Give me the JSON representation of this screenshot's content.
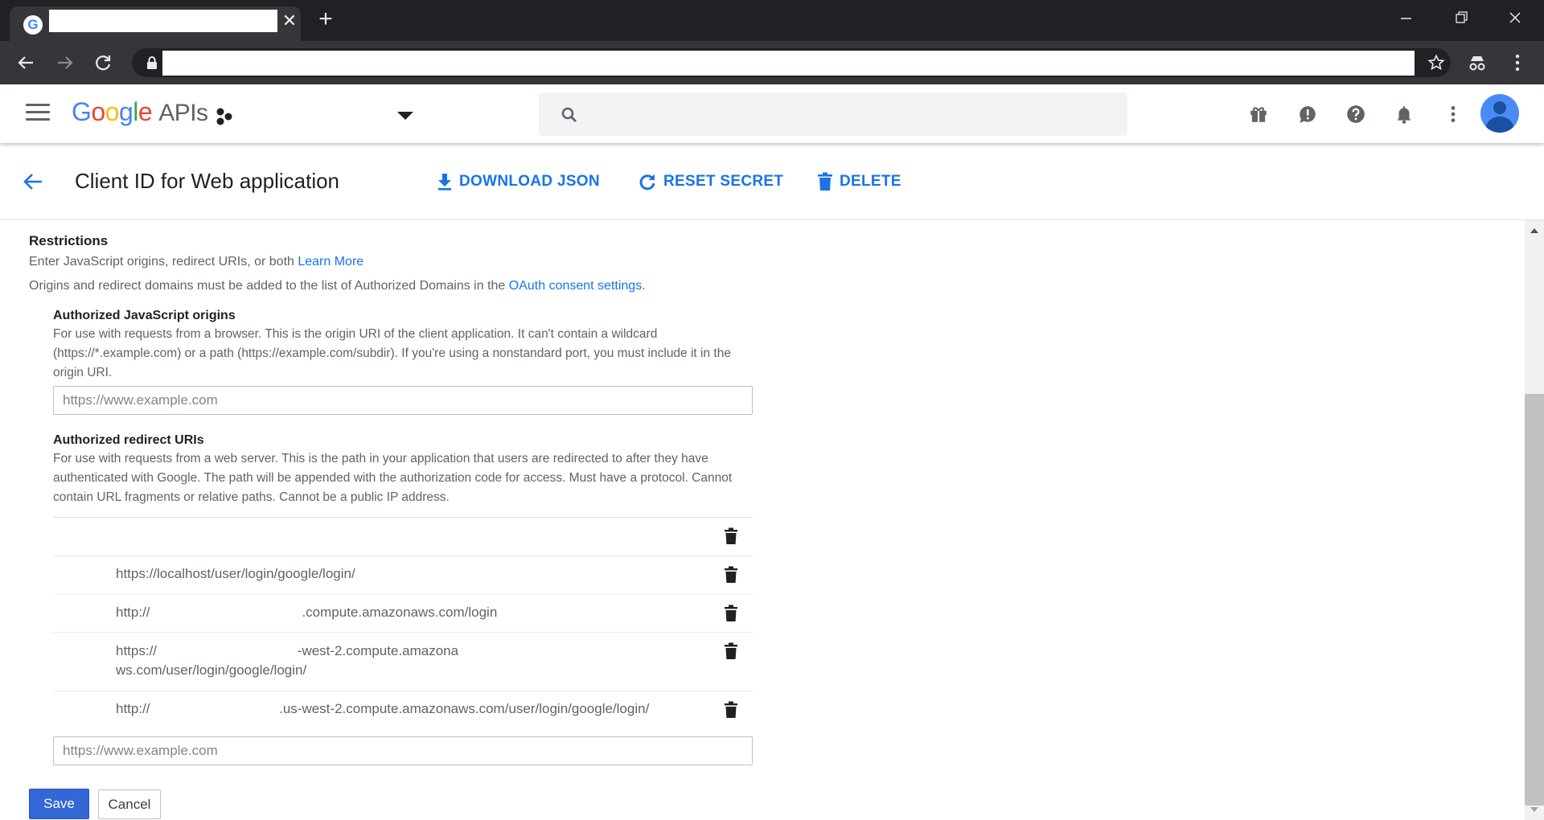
{
  "browser": {
    "tab_favicon_letter": "G",
    "tab_close_glyph": "✕",
    "new_tab_glyph": "+"
  },
  "header": {
    "logo": [
      "G",
      "o",
      "o",
      "g",
      "l",
      "e"
    ],
    "logo_suffix": "APIs",
    "search_placeholder": "",
    "icons": [
      "gift-icon",
      "feedback-icon",
      "help-icon",
      "notifications-icon",
      "more-vert-icon"
    ]
  },
  "titlebar": {
    "title": "Client ID for Web application",
    "download_label": "DOWNLOAD JSON",
    "reset_label": "RESET SECRET",
    "delete_label": "DELETE"
  },
  "restrictions": {
    "title": "Restrictions",
    "intro_text": "Enter JavaScript origins, redirect URIs, or both ",
    "learn_more": "Learn More",
    "domains_text": "Origins and redirect domains must be added to the list of Authorized Domains in the ",
    "oauth_link": "OAuth consent settings",
    "domains_suffix": "."
  },
  "js_origins": {
    "title": "Authorized JavaScript origins",
    "description": "For use with requests from a browser. This is the origin URI of the client application. It can't contain a wildcard (https://*.example.com) or a path (https://example.com/subdir). If you're using a nonstandard port, you must include it in the origin URI.",
    "placeholder": "https://www.example.com"
  },
  "redirect_uris": {
    "title": "Authorized redirect URIs",
    "description": "For use with requests from a web server. This is the path in your application that users are redirected to after they have authenticated with Google. The path will be appended with the authorization code for access. Must have a protocol. Cannot contain URL fragments or relative paths. Cannot be a public IP address.",
    "uris": [
      "",
      "https://localhost/user/login/google/login/",
      "http://                                        .compute.amazonaws.com/login",
      "https://                                     -west-2.compute.amazonaws.com/user/login/google/login/",
      "http://                                  .us-west-2.compute.amazonaws.com/user/login/google/login/"
    ],
    "placeholder": "https://www.example.com"
  },
  "footer": {
    "save_label": "Save",
    "cancel_label": "Cancel"
  },
  "colors": {
    "accent": "#1a73e8",
    "save_button": "#3367d6",
    "chrome_dark": "#202124"
  }
}
